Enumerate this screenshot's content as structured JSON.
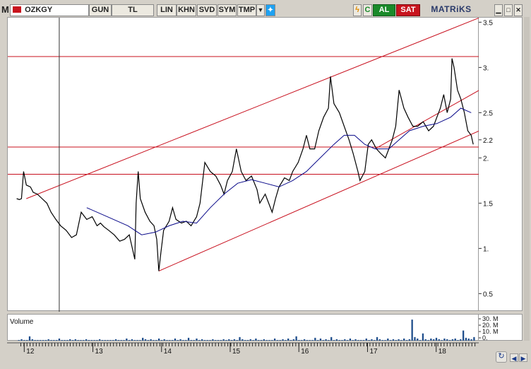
{
  "toolbar": {
    "logo": "M",
    "symbol": "OZKGY",
    "period": "GUN",
    "currency": "TL",
    "scale": "LIN",
    "buttons": [
      "KHN",
      "SVD",
      "SYM",
      "TMP"
    ],
    "dropdown_icon": "triangle-down-icon",
    "bird_icon": "twitter-bird-icon",
    "flash_icon": "lightning-icon",
    "refresh_label": "C",
    "buy_label": "AL",
    "sell_label": "SAT",
    "brand": "MATRiKS",
    "window_controls": [
      "minimize",
      "restore",
      "close"
    ]
  },
  "volume_panel": {
    "label": "Volume",
    "ticks": [
      "30. M",
      "20. M",
      "10. M",
      "0."
    ]
  },
  "colors": {
    "price": "#000000",
    "moving_average": "#0a0a8a",
    "lines": "#c8101e",
    "volume": "#1f4e8c",
    "crosshair": "#333333"
  },
  "chart_data": {
    "type": "line",
    "symbol": "OZKGY",
    "x_tick_labels": [
      "12",
      "13",
      "14",
      "15",
      "16",
      "17",
      "18"
    ],
    "y_tick_labels": [
      "3.5",
      "3.",
      "2.5",
      "2.2",
      "2.",
      "1.5",
      "1.",
      "0.5"
    ],
    "y_ticks": [
      3.5,
      3.0,
      2.5,
      2.2,
      2.0,
      1.5,
      1.0,
      0.5
    ],
    "ylim": [
      0.3,
      3.55
    ],
    "xlim": [
      11.75,
      18.62
    ],
    "grid": false,
    "price_series": [
      [
        11.88,
        1.55
      ],
      [
        11.92,
        1.54
      ],
      [
        11.95,
        1.55
      ],
      [
        11.98,
        1.85
      ],
      [
        12.02,
        1.7
      ],
      [
        12.08,
        1.68
      ],
      [
        12.12,
        1.62
      ],
      [
        12.18,
        1.6
      ],
      [
        12.25,
        1.55
      ],
      [
        12.32,
        1.5
      ],
      [
        12.38,
        1.4
      ],
      [
        12.45,
        1.32
      ],
      [
        12.52,
        1.25
      ],
      [
        12.6,
        1.2
      ],
      [
        12.68,
        1.12
      ],
      [
        12.75,
        1.15
      ],
      [
        12.82,
        1.4
      ],
      [
        12.9,
        1.32
      ],
      [
        12.98,
        1.35
      ],
      [
        13.05,
        1.25
      ],
      [
        13.1,
        1.28
      ],
      [
        13.15,
        1.24
      ],
      [
        13.22,
        1.2
      ],
      [
        13.3,
        1.15
      ],
      [
        13.38,
        1.08
      ],
      [
        13.45,
        1.1
      ],
      [
        13.52,
        1.15
      ],
      [
        13.55,
        1.05
      ],
      [
        13.6,
        0.88
      ],
      [
        13.62,
        1.5
      ],
      [
        13.65,
        1.85
      ],
      [
        13.68,
        1.55
      ],
      [
        13.75,
        1.4
      ],
      [
        13.82,
        1.3
      ],
      [
        13.88,
        1.25
      ],
      [
        13.92,
        1.1
      ],
      [
        13.95,
        0.75
      ],
      [
        13.98,
        0.95
      ],
      [
        14.02,
        1.2
      ],
      [
        14.1,
        1.3
      ],
      [
        14.15,
        1.45
      ],
      [
        14.2,
        1.32
      ],
      [
        14.28,
        1.28
      ],
      [
        14.35,
        1.3
      ],
      [
        14.42,
        1.25
      ],
      [
        14.5,
        1.35
      ],
      [
        14.55,
        1.5
      ],
      [
        14.62,
        1.95
      ],
      [
        14.7,
        1.85
      ],
      [
        14.78,
        1.8
      ],
      [
        14.85,
        1.7
      ],
      [
        14.9,
        1.6
      ],
      [
        14.95,
        1.75
      ],
      [
        15.02,
        1.85
      ],
      [
        15.08,
        2.1
      ],
      [
        15.15,
        1.85
      ],
      [
        15.22,
        1.75
      ],
      [
        15.3,
        1.8
      ],
      [
        15.38,
        1.65
      ],
      [
        15.42,
        1.5
      ],
      [
        15.5,
        1.6
      ],
      [
        15.55,
        1.5
      ],
      [
        15.6,
        1.4
      ],
      [
        15.65,
        1.55
      ],
      [
        15.7,
        1.68
      ],
      [
        15.78,
        1.78
      ],
      [
        15.85,
        1.75
      ],
      [
        15.9,
        1.85
      ],
      [
        15.98,
        1.95
      ],
      [
        16.05,
        2.1
      ],
      [
        16.1,
        2.25
      ],
      [
        16.15,
        2.1
      ],
      [
        16.22,
        2.1
      ],
      [
        16.28,
        2.3
      ],
      [
        16.35,
        2.45
      ],
      [
        16.42,
        2.55
      ],
      [
        16.45,
        2.9
      ],
      [
        16.5,
        2.6
      ],
      [
        16.58,
        2.5
      ],
      [
        16.65,
        2.35
      ],
      [
        16.72,
        2.2
      ],
      [
        16.78,
        2.05
      ],
      [
        16.85,
        1.85
      ],
      [
        16.88,
        1.75
      ],
      [
        16.95,
        1.85
      ],
      [
        17.0,
        2.15
      ],
      [
        17.05,
        2.2
      ],
      [
        17.12,
        2.1
      ],
      [
        17.18,
        2.05
      ],
      [
        17.25,
        2.0
      ],
      [
        17.3,
        2.1
      ],
      [
        17.35,
        2.2
      ],
      [
        17.4,
        2.35
      ],
      [
        17.45,
        2.75
      ],
      [
        17.52,
        2.55
      ],
      [
        17.58,
        2.45
      ],
      [
        17.65,
        2.35
      ],
      [
        17.72,
        2.35
      ],
      [
        17.8,
        2.4
      ],
      [
        17.88,
        2.3
      ],
      [
        17.95,
        2.35
      ],
      [
        18.0,
        2.45
      ],
      [
        18.05,
        2.55
      ],
      [
        18.1,
        2.7
      ],
      [
        18.15,
        2.5
      ],
      [
        18.2,
        2.65
      ],
      [
        18.22,
        3.1
      ],
      [
        18.25,
        3.0
      ],
      [
        18.3,
        2.75
      ],
      [
        18.35,
        2.65
      ],
      [
        18.4,
        2.5
      ],
      [
        18.45,
        2.3
      ],
      [
        18.5,
        2.25
      ],
      [
        18.53,
        2.15
      ]
    ],
    "moving_average": [
      [
        12.9,
        1.45
      ],
      [
        13.2,
        1.35
      ],
      [
        13.5,
        1.25
      ],
      [
        13.7,
        1.15
      ],
      [
        13.9,
        1.18
      ],
      [
        14.1,
        1.25
      ],
      [
        14.3,
        1.3
      ],
      [
        14.5,
        1.28
      ],
      [
        14.7,
        1.45
      ],
      [
        14.9,
        1.6
      ],
      [
        15.1,
        1.72
      ],
      [
        15.3,
        1.76
      ],
      [
        15.5,
        1.72
      ],
      [
        15.7,
        1.68
      ],
      [
        15.9,
        1.75
      ],
      [
        16.1,
        1.85
      ],
      [
        16.3,
        2.0
      ],
      [
        16.5,
        2.15
      ],
      [
        16.65,
        2.25
      ],
      [
        16.8,
        2.25
      ],
      [
        16.95,
        2.15
      ],
      [
        17.1,
        2.1
      ],
      [
        17.3,
        2.1
      ],
      [
        17.45,
        2.2
      ],
      [
        17.6,
        2.3
      ],
      [
        17.8,
        2.35
      ],
      [
        18.0,
        2.38
      ],
      [
        18.2,
        2.45
      ],
      [
        18.35,
        2.55
      ],
      [
        18.5,
        2.5
      ]
    ],
    "channel_lines": [
      {
        "from": [
          12.02,
          1.55
        ],
        "to": [
          18.62,
          3.55
        ]
      },
      {
        "from": [
          13.95,
          0.75
        ],
        "to": [
          18.62,
          2.3
        ]
      },
      {
        "from": [
          17.1,
          2.1
        ],
        "to": [
          18.62,
          2.75
        ]
      }
    ],
    "horizontal_levels": [
      3.12,
      2.12,
      1.82
    ],
    "crosshair_x": 12.5,
    "volume_millions": [
      1,
      2,
      1,
      1,
      6,
      2,
      1,
      1,
      1,
      1,
      1,
      2,
      1,
      1,
      1,
      3,
      1,
      1,
      1,
      2,
      1,
      2,
      1,
      1,
      1,
      2,
      1,
      1,
      1,
      1,
      2,
      1,
      1,
      1,
      1,
      1,
      2,
      1,
      1,
      1,
      3,
      1,
      2,
      1,
      1,
      1,
      4,
      2,
      1,
      2,
      1,
      1,
      3,
      1,
      2,
      1,
      1,
      1,
      3,
      1,
      2,
      1,
      1,
      4,
      1,
      1,
      3,
      1,
      2,
      1,
      1,
      1,
      2,
      1,
      1,
      1,
      2,
      1,
      2,
      1,
      2,
      1,
      5,
      2,
      1,
      1,
      2,
      1,
      3,
      1,
      1,
      2,
      1,
      1,
      1,
      3,
      1,
      1,
      2,
      1,
      3,
      1,
      2,
      6,
      1,
      1,
      2,
      1,
      1,
      1,
      4,
      1,
      3,
      1,
      2,
      1,
      5,
      1,
      2,
      1,
      1,
      2,
      1,
      3,
      1,
      2,
      1,
      1,
      1,
      3,
      1,
      2,
      1,
      5,
      2,
      1,
      1,
      3,
      1,
      2,
      1,
      2,
      1,
      3,
      1,
      2,
      29,
      5,
      3,
      1,
      10,
      2,
      1,
      3,
      2,
      4,
      2,
      1,
      3,
      2,
      1,
      2,
      3,
      1,
      2,
      14,
      4,
      3,
      2,
      5
    ]
  }
}
